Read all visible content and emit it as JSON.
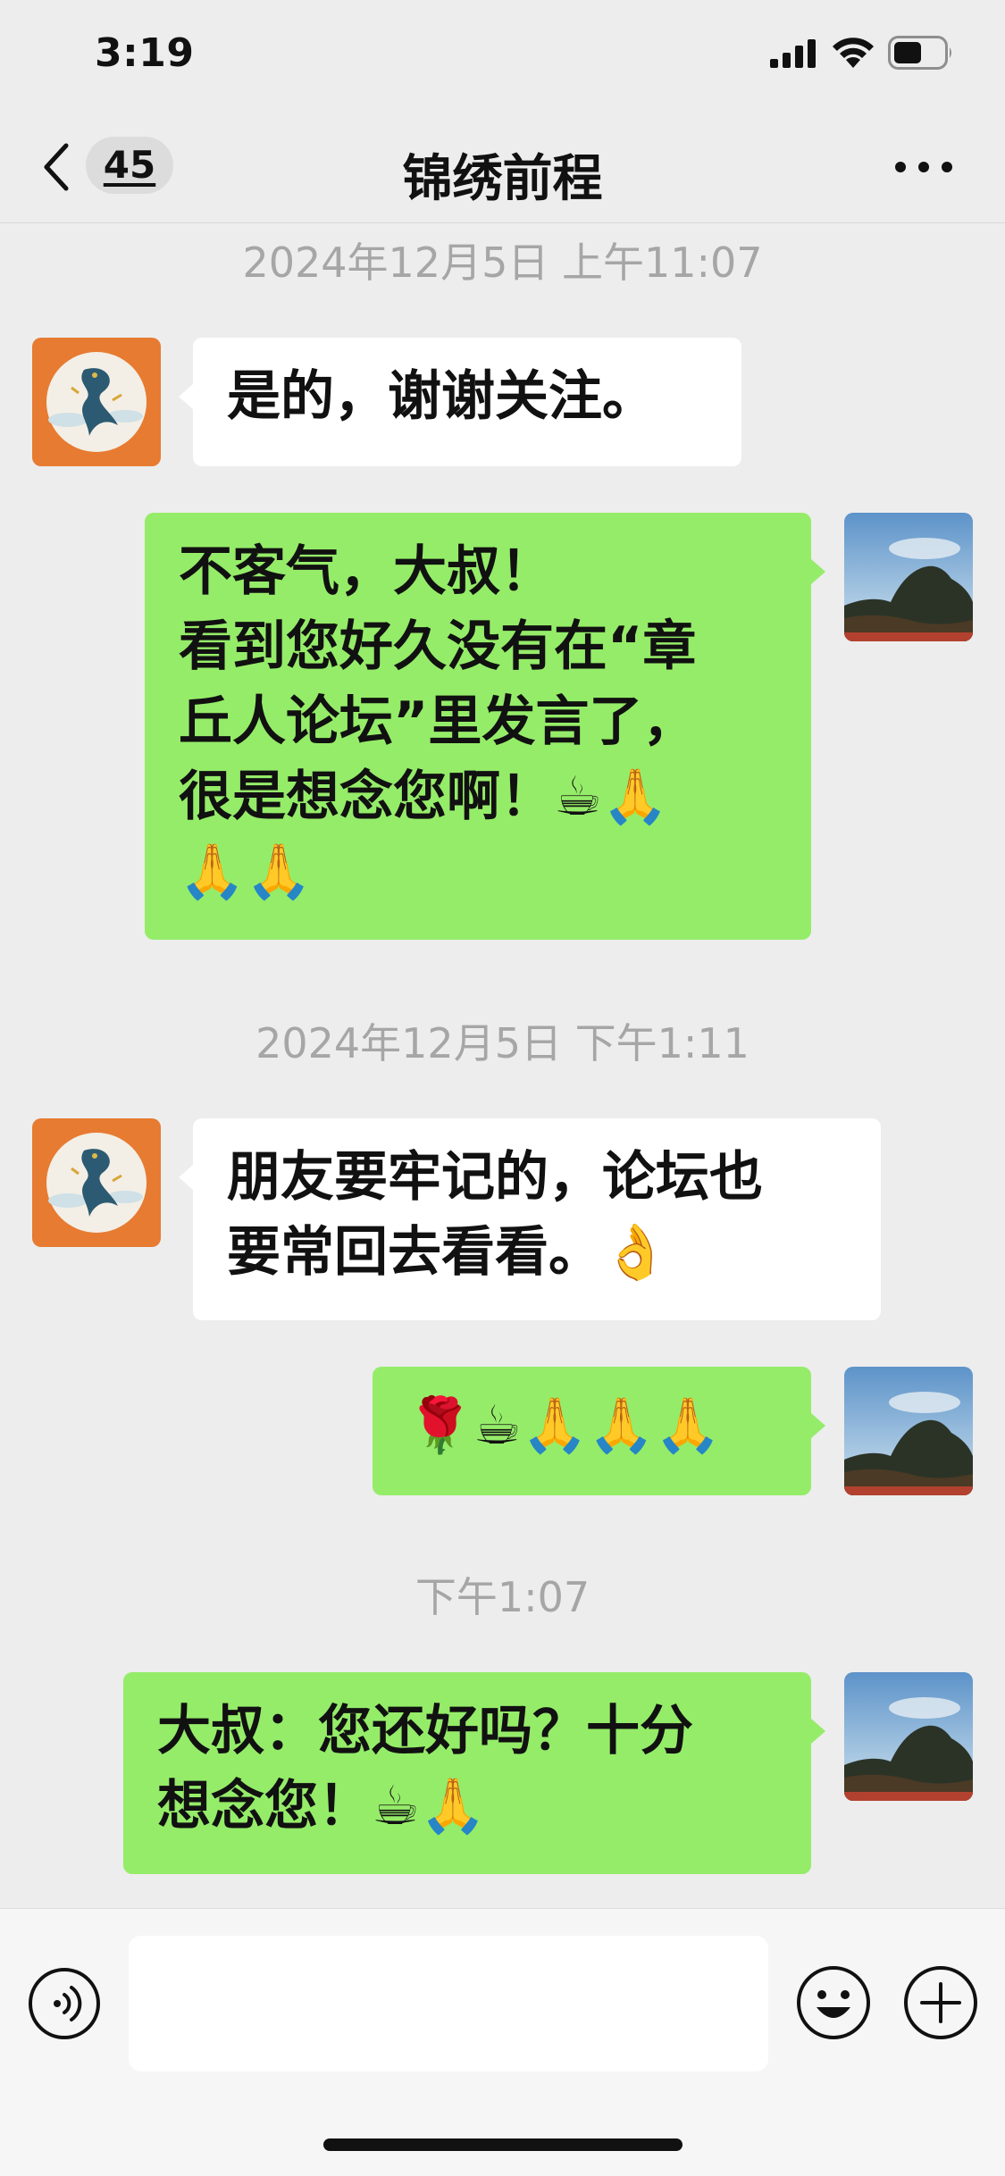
{
  "status_bar": {
    "time": "3:19"
  },
  "header": {
    "unread_count": "45",
    "title": "锦绣前程"
  },
  "messages": [
    {
      "type": "timestamp",
      "text": "2024年12月5日 上午11:07"
    },
    {
      "type": "message",
      "side": "in",
      "text": "是的，谢谢关注。"
    },
    {
      "type": "message",
      "side": "out",
      "text": "不客气，大叔！\n看到您好久没有在“章\n丘人论坛”里发言了，\n很是想念您啊！☕🙏\n🙏🙏"
    },
    {
      "type": "timestamp",
      "text": "2024年12月5日 下午1:11"
    },
    {
      "type": "message",
      "side": "in",
      "text": "朋友要牢记的，论坛也\n要常回去看看。👌"
    },
    {
      "type": "message",
      "side": "out",
      "text": "🌹☕🙏🙏🙏"
    },
    {
      "type": "timestamp",
      "text": "下午1:07"
    },
    {
      "type": "message",
      "side": "out",
      "text": "大叔：您还好吗？十分\n想念您！☕🙏"
    }
  ],
  "input": {
    "placeholder": ""
  },
  "icons": {
    "back": "chevron-left-icon",
    "more": "more-icon",
    "voice": "voice-icon",
    "emoji": "emoji-icon",
    "add": "plus-icon"
  },
  "colors": {
    "background": "#ededed",
    "outgoing_bubble": "#95ec69",
    "incoming_bubble": "#ffffff",
    "timestamp_text": "#a6a6a6"
  }
}
